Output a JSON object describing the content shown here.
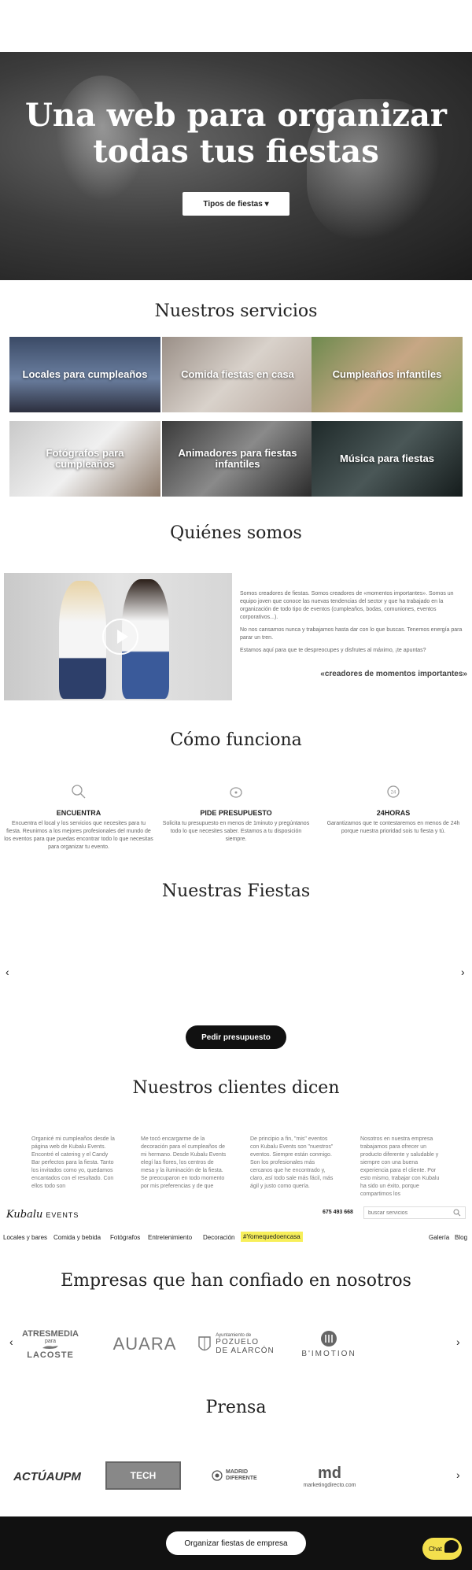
{
  "hero": {
    "title_line1": "Una web para organizar",
    "title_line2": "todas tus fiestas",
    "button": "Tipos de fiestas ▾"
  },
  "services": {
    "title": "Nuestros servicios",
    "items": [
      {
        "label": "Locales para cumpleaños"
      },
      {
        "label": "Comida fiestas en casa"
      },
      {
        "label": "Cumpleaños infantiles"
      },
      {
        "label": "Fotógrafos para cumpleaños"
      },
      {
        "label": "Animadores para fiestas infantiles"
      },
      {
        "label": "Música para fiestas"
      }
    ]
  },
  "about": {
    "title": "Quiénes somos",
    "p1": "Somos creadores de fiestas. Somos creadores de «momentos importantes». Somos un equipo joven que conoce las nuevas tendencias del sector y que ha trabajado en la organización de todo tipo de eventos (cumpleaños, bodas, comuniones, eventos corporativos...).",
    "p2": "No nos cansamos nunca y trabajamos hasta dar con lo que buscas. Tenemos energía para parar un tren.",
    "p3": "Estamos aquí para que te despreocupes y disfrutes al máximo, ¡te apuntas?",
    "quote": "«creadores de momentos importantes»"
  },
  "how": {
    "title": "Cómo funciona",
    "steps": [
      {
        "title": "ENCUENTRA",
        "text": "Encuentra el local y los servicios que necesites para tu fiesta. Reunimos a los mejores profesionales del mundo de los eventos para que puedas encontrar todo lo que necesitas para organizar tu evento."
      },
      {
        "title": "PIDE PRESUPUESTO",
        "text": "Solicita tu presupuesto en menos de 1minuto y pregúntanos todo lo que necesites saber. Estamos a tu disposición siempre."
      },
      {
        "title": "24HORAS",
        "text": "Garantizamos que te contestaremos en menos de 24h porque nuestra prioridad sois tu fiesta y tú."
      }
    ]
  },
  "parties": {
    "title": "Nuestras Fiestas",
    "button": "Pedir presupuesto"
  },
  "testimonials": {
    "title": "Nuestros clientes dicen",
    "items": [
      {
        "text": "Organicé mi cumpleaños desde la página web de Kubalu Events. Encontré el catering y el Candy Bar perfectos para la fiesta. Tanto los invitados como yo, quedamos encantados con el resultado. Con ellos todo son"
      },
      {
        "text": "Me tocó encargarme de la decoración para el cumpleaños de mi hermano. Desde Kubalu Events elegí las flores, los centros de mesa y la iluminación de la fiesta. Se preocuparon en todo momento por mis preferencias y de que"
      },
      {
        "text": "De principio a fin, \"mis\" eventos con Kubalu Events son \"nuestros\" eventos. Siempre están conmigo. Son los profesionales más cercanos que he encontrado y, claro, así todo sale más fácil, más ágil y justo como quería."
      },
      {
        "text": "Nosotros en nuestra empresa trabajamos para ofrecer un producto diferente y saludable y siempre con una buena experiencia para el cliente. Por esto mismo, trabajar con Kubalu ha sido un éxito, porque compartimos los"
      }
    ]
  },
  "header": {
    "logo": "Kubalu",
    "logo_sub": "EVENTS",
    "phone": "675 493 668",
    "search_placeholder": "buscar servicios"
  },
  "nav": {
    "items": [
      "Locales y bares",
      "Comida y bebida",
      "Fotógrafos",
      "Entretenimiento",
      "Decoración"
    ],
    "highlight": "#Yomequedoencasa",
    "right": [
      "Galería",
      "Blog"
    ]
  },
  "companies": {
    "title": "Empresas que han confiado en nosotros",
    "logos": [
      {
        "l1": "ATRESMEDIA",
        "l2": "para",
        "l3": "LACOSTE"
      },
      {
        "name": "AUARA"
      },
      {
        "l1": "Ayuntamiento de",
        "l2": "POZUELO",
        "l3": "DE ALARCÓN"
      },
      {
        "name": "B'IMOTION"
      }
    ]
  },
  "press": {
    "title": "Prensa",
    "logos": [
      {
        "name": "ACTÚAUPM"
      },
      {
        "name": "TECH"
      },
      {
        "name": "MADRID DIFERENTE"
      },
      {
        "name": "md",
        "sub": "marketingdirecto.com"
      }
    ]
  },
  "footer": {
    "button": "Organizar fiestas de empresa",
    "chat": "Chat"
  },
  "colors": {
    "highlight": "#f7ef5a",
    "chat": "#f4e04d",
    "dark": "#111111"
  }
}
